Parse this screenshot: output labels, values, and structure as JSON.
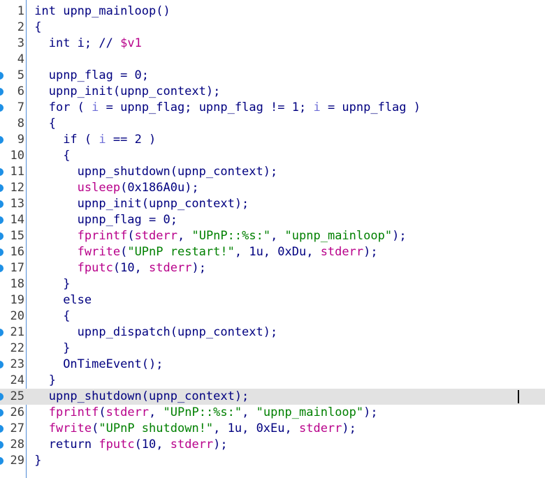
{
  "editor": {
    "cursor_line": 25,
    "lines": [
      {
        "n": "1",
        "bp": false,
        "indent": 0,
        "tokens": [
          [
            "kw",
            "int "
          ],
          [
            "fn",
            "upnp_mainloop"
          ],
          [
            "p",
            "()"
          ]
        ]
      },
      {
        "n": "2",
        "bp": false,
        "indent": 0,
        "tokens": [
          [
            "p",
            "{"
          ]
        ]
      },
      {
        "n": "3",
        "bp": false,
        "indent": 1,
        "tokens": [
          [
            "kw",
            "int "
          ],
          [
            "p",
            "i; "
          ],
          [
            "cmt",
            "// "
          ],
          [
            "cmtv",
            "$v1"
          ]
        ]
      },
      {
        "n": "4",
        "bp": false,
        "indent": 0,
        "tokens": []
      },
      {
        "n": "5",
        "bp": true,
        "indent": 1,
        "tokens": [
          [
            "p",
            "upnp_flag = 0;"
          ]
        ]
      },
      {
        "n": "6",
        "bp": true,
        "indent": 1,
        "tokens": [
          [
            "p",
            "upnp_init(upnp_context);"
          ]
        ]
      },
      {
        "n": "7",
        "bp": true,
        "indent": 1,
        "tokens": [
          [
            "kw",
            "for "
          ],
          [
            "p",
            "( "
          ],
          [
            "var",
            "i"
          ],
          [
            "p",
            " = upnp_flag; upnp_flag != 1; "
          ],
          [
            "var",
            "i"
          ],
          [
            "p",
            " = upnp_flag )"
          ]
        ]
      },
      {
        "n": "8",
        "bp": false,
        "indent": 1,
        "tokens": [
          [
            "p",
            "{"
          ]
        ]
      },
      {
        "n": "9",
        "bp": true,
        "indent": 2,
        "tokens": [
          [
            "kw",
            "if "
          ],
          [
            "p",
            "( "
          ],
          [
            "var",
            "i"
          ],
          [
            "p",
            " == 2 )"
          ]
        ]
      },
      {
        "n": "10",
        "bp": false,
        "indent": 2,
        "tokens": [
          [
            "p",
            "{"
          ]
        ]
      },
      {
        "n": "11",
        "bp": true,
        "indent": 3,
        "tokens": [
          [
            "p",
            "upnp_shutdown(upnp_context);"
          ]
        ]
      },
      {
        "n": "12",
        "bp": true,
        "indent": 3,
        "tokens": [
          [
            "lib",
            "usleep"
          ],
          [
            "p",
            "(0x186A0u);"
          ]
        ]
      },
      {
        "n": "13",
        "bp": true,
        "indent": 3,
        "tokens": [
          [
            "p",
            "upnp_init(upnp_context);"
          ]
        ]
      },
      {
        "n": "14",
        "bp": true,
        "indent": 3,
        "tokens": [
          [
            "p",
            "upnp_flag = 0;"
          ]
        ]
      },
      {
        "n": "15",
        "bp": true,
        "indent": 3,
        "tokens": [
          [
            "lib",
            "fprintf"
          ],
          [
            "p",
            "("
          ],
          [
            "lib",
            "stderr"
          ],
          [
            "p",
            ", "
          ],
          [
            "str",
            "\"UPnP::%s:\""
          ],
          [
            "p",
            ", "
          ],
          [
            "str",
            "\"upnp_mainloop\""
          ],
          [
            "p",
            ");"
          ]
        ]
      },
      {
        "n": "16",
        "bp": true,
        "indent": 3,
        "tokens": [
          [
            "lib",
            "fwrite"
          ],
          [
            "p",
            "("
          ],
          [
            "str",
            "\"UPnP restart!\""
          ],
          [
            "p",
            ", 1u, 0xDu, "
          ],
          [
            "lib",
            "stderr"
          ],
          [
            "p",
            ");"
          ]
        ]
      },
      {
        "n": "17",
        "bp": true,
        "indent": 3,
        "tokens": [
          [
            "lib",
            "fputc"
          ],
          [
            "p",
            "(10, "
          ],
          [
            "lib",
            "stderr"
          ],
          [
            "p",
            ");"
          ]
        ]
      },
      {
        "n": "18",
        "bp": false,
        "indent": 2,
        "tokens": [
          [
            "p",
            "}"
          ]
        ]
      },
      {
        "n": "19",
        "bp": false,
        "indent": 2,
        "tokens": [
          [
            "kw",
            "else"
          ]
        ]
      },
      {
        "n": "20",
        "bp": false,
        "indent": 2,
        "tokens": [
          [
            "p",
            "{"
          ]
        ]
      },
      {
        "n": "21",
        "bp": true,
        "indent": 3,
        "tokens": [
          [
            "p",
            "upnp_dispatch(upnp_context);"
          ]
        ]
      },
      {
        "n": "22",
        "bp": false,
        "indent": 2,
        "tokens": [
          [
            "p",
            "}"
          ]
        ]
      },
      {
        "n": "23",
        "bp": true,
        "indent": 2,
        "tokens": [
          [
            "p",
            "OnTimeEvent();"
          ]
        ]
      },
      {
        "n": "24",
        "bp": false,
        "indent": 1,
        "tokens": [
          [
            "p",
            "}"
          ]
        ]
      },
      {
        "n": "25",
        "bp": true,
        "indent": 1,
        "tokens": [
          [
            "p",
            "upnp_shutdown(upnp_context);"
          ]
        ]
      },
      {
        "n": "26",
        "bp": true,
        "indent": 1,
        "tokens": [
          [
            "lib",
            "fprintf"
          ],
          [
            "p",
            "("
          ],
          [
            "lib",
            "stderr"
          ],
          [
            "p",
            ", "
          ],
          [
            "str",
            "\"UPnP::%s:\""
          ],
          [
            "p",
            ", "
          ],
          [
            "str",
            "\"upnp_mainloop\""
          ],
          [
            "p",
            ");"
          ]
        ]
      },
      {
        "n": "27",
        "bp": true,
        "indent": 1,
        "tokens": [
          [
            "lib",
            "fwrite"
          ],
          [
            "p",
            "("
          ],
          [
            "str",
            "\"UPnP shutdown!\""
          ],
          [
            "p",
            ", 1u, 0xEu, "
          ],
          [
            "lib",
            "stderr"
          ],
          [
            "p",
            ");"
          ]
        ]
      },
      {
        "n": "28",
        "bp": true,
        "indent": 1,
        "tokens": [
          [
            "kw",
            "return "
          ],
          [
            "lib",
            "fputc"
          ],
          [
            "p",
            "(10, "
          ],
          [
            "lib",
            "stderr"
          ],
          [
            "p",
            ");"
          ]
        ]
      },
      {
        "n": "29",
        "bp": true,
        "indent": 0,
        "tokens": [
          [
            "p",
            "}"
          ]
        ]
      }
    ]
  },
  "colors": {
    "background": "#ffffff",
    "default_text": "#000080",
    "library_call": "#b8008a",
    "local_var": "#6f6fd8",
    "string": "#008000",
    "line_number": "#3e3e3e",
    "breakpoint_marker": "#1e90e6",
    "current_line_highlight": "#e2e2e2",
    "gutter_border": "#4f8ad6"
  }
}
